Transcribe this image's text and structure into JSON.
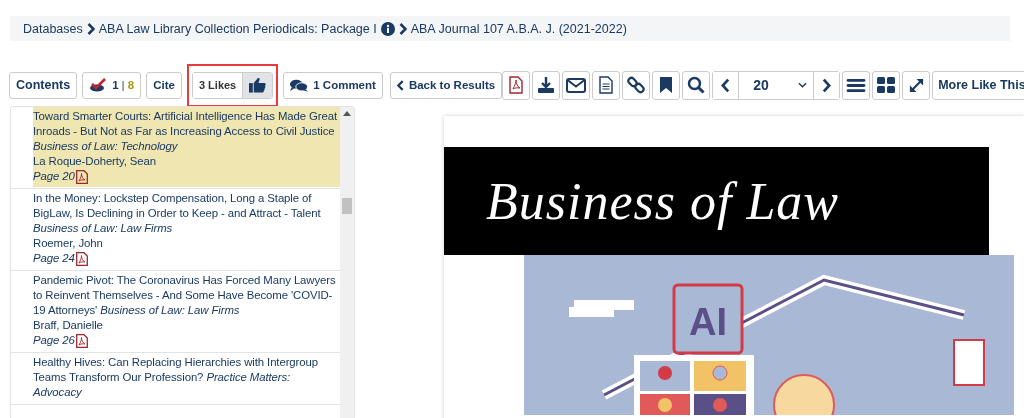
{
  "breadcrumb": [
    {
      "label": "Databases",
      "info": false
    },
    {
      "label": "ABA Law Library Collection Periodicals: Package I",
      "info": true
    },
    {
      "label": "ABA Journal 107 A.B.A. J. (2021-2022)",
      "info": false
    }
  ],
  "toolbar": {
    "contents": "Contents",
    "marked": {
      "count": "1",
      "separator": "|",
      "total": "8"
    },
    "cite": "Cite",
    "likes": {
      "label": "3 Likes",
      "liked": true,
      "highlighted": true
    },
    "comments": "1 Comment",
    "back": "Back to Results",
    "page_select": "20",
    "more": "More Like This"
  },
  "articles": [
    {
      "title": "Toward Smarter Courts: Artificial Intelligence Has Made Great Inroads - But Not as Far as Increasing Access to Civil Justice",
      "section": "Business of Law: Technology",
      "author": "La Roque-Doherty, Sean",
      "page": "Page 20",
      "selected": true
    },
    {
      "title": "In the Money: Lockstep Compensation, Long a Staple of BigLaw, Is Declining in Order to Keep - and Attract - Talent",
      "section": "Business of Law: Law Firms",
      "author": "Roemer, John",
      "page": "Page 24",
      "selected": false
    },
    {
      "title": "Pandemic Pivot: The Coronavirus Has Forced Many Lawyers to Reinvent Themselves - And Some Have Become 'COVID-19 Attorneys'",
      "section": "Business of Law: Law Firms",
      "author": "Braff, Danielle",
      "page": "Page 26",
      "selected": false
    },
    {
      "title": "Healthy Hives: Can Replacing Hierarchies with Intergroup Teams Transform Our Profession?",
      "section": "Practice Matters: Advocacy",
      "selected": false
    }
  ],
  "document": {
    "banner": "Business of Law",
    "illustration_label": "AI"
  }
}
